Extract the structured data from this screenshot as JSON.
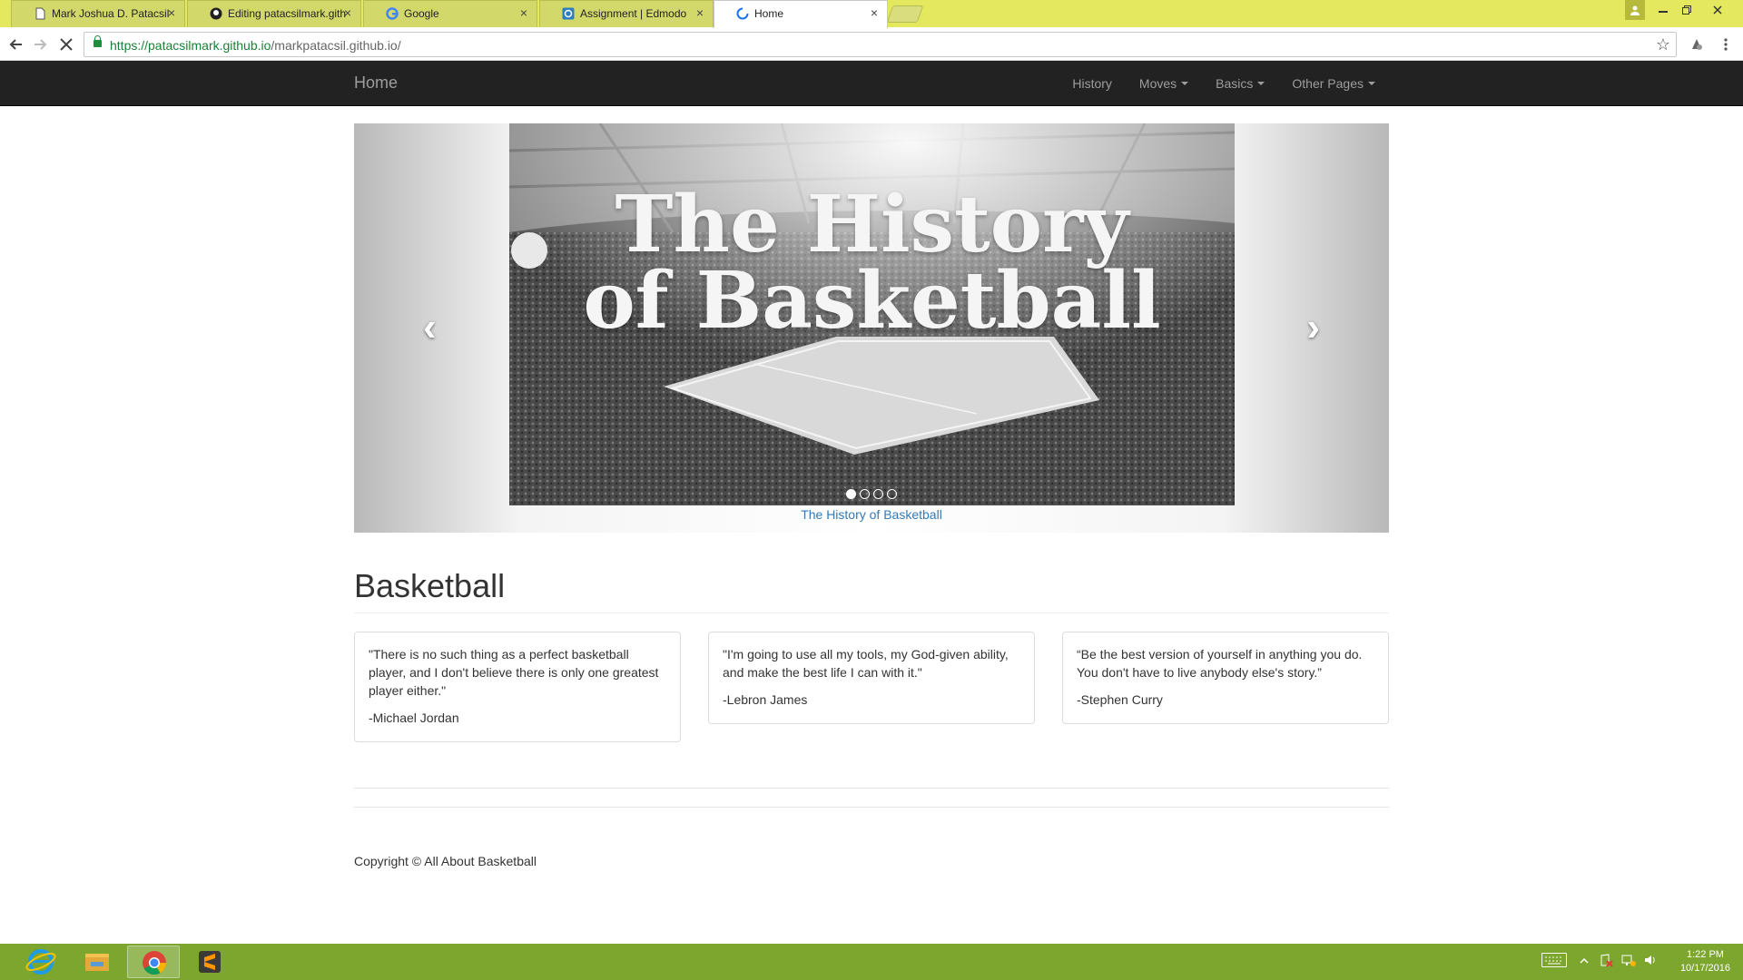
{
  "browser": {
    "tabs": [
      {
        "title": "Mark Joshua D. Patacsil",
        "icon": "page-icon"
      },
      {
        "title": "Editing patacsilmark.gith",
        "icon": "github-icon"
      },
      {
        "title": "Google",
        "icon": "google-icon"
      },
      {
        "title": "Assignment | Edmodo",
        "icon": "edmodo-icon"
      },
      {
        "title": "Home",
        "icon": "loading-icon",
        "active": true
      }
    ],
    "close_glyph": "×",
    "url_host": "https://patacsilmark.github.io",
    "url_path": "/markpatacsil.github.io/"
  },
  "nav": {
    "brand": "Home",
    "links": [
      {
        "label": "History",
        "dropdown": false
      },
      {
        "label": "Moves",
        "dropdown": true
      },
      {
        "label": "Basics",
        "dropdown": true
      },
      {
        "label": "Other Pages",
        "dropdown": true
      }
    ]
  },
  "carousel": {
    "slide_title_line1": "The History",
    "slide_title_line2": "of Basketball",
    "caption": "The History of Basketball",
    "indicator_count": 4,
    "active_index": 0,
    "prev_glyph": "‹",
    "next_glyph": "›"
  },
  "main": {
    "heading": "Basketball",
    "quotes": [
      {
        "text": "\"There is no such thing as a perfect basketball player, and I don't believe there is only one greatest player either.\"",
        "author": "-Michael Jordan"
      },
      {
        "text": "\"I'm going to use all my tools, my God-given ability, and make the best life I can with it.\"",
        "author": "-Lebron James"
      },
      {
        "text": "“Be the best version of yourself in anything you do. You don't have to live anybody else's story.”",
        "author": "-Stephen Curry"
      }
    ]
  },
  "footer": {
    "copyright": "Copyright © All About Basketball"
  },
  "taskbar": {
    "apps": [
      "internet-explorer-icon",
      "file-explorer-icon",
      "chrome-icon",
      "sublime-text-icon"
    ],
    "time": "1:22 PM",
    "date": "10/17/2016"
  },
  "colors": {
    "tabstrip": "#e3e85e",
    "navbar": "#222222",
    "link": "#337ab7",
    "taskbar": "#7ca62e"
  }
}
